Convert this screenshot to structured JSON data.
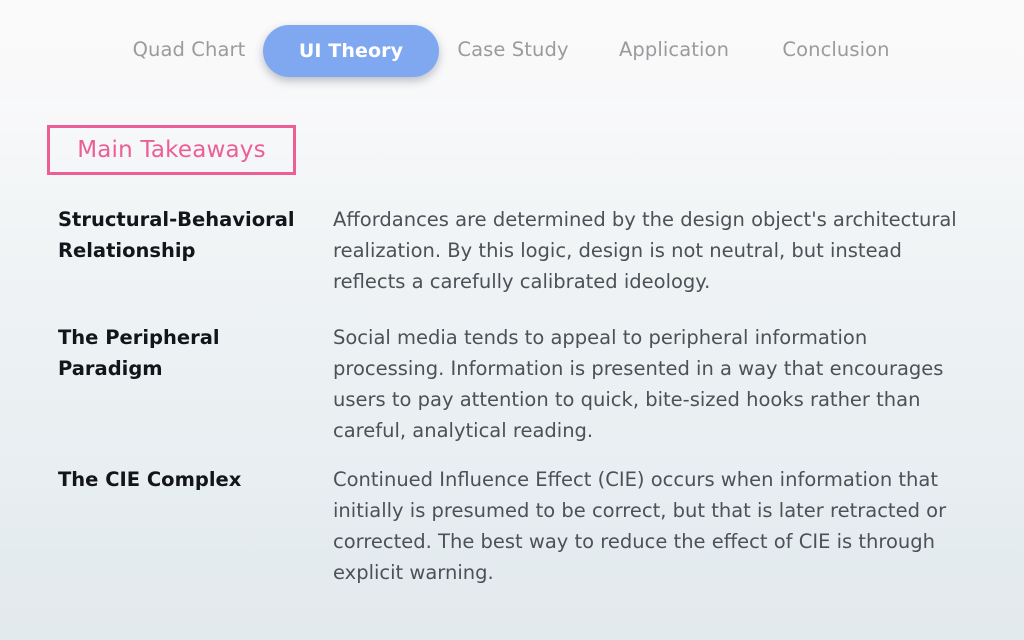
{
  "nav": {
    "tabs": [
      {
        "label": "Quad Chart",
        "active": false
      },
      {
        "label": "UI Theory",
        "active": true
      },
      {
        "label": "Case Study",
        "active": false
      },
      {
        "label": "Application",
        "active": false
      },
      {
        "label": "Conclusion",
        "active": false
      }
    ],
    "active_color": "#7fa8f0",
    "inactive_color": "#9b9b9f"
  },
  "section": {
    "title": "Main Takeaways",
    "title_color": "#ec5f95",
    "border_color": "#ec5f95"
  },
  "takeaways": [
    {
      "heading": "Structural-Behavioral Relationship",
      "body": "Affordances are determined by the design object's architectural realization. By this logic, design is not neutral, but instead reflects a carefully calibrated ideology."
    },
    {
      "heading": "The Peripheral Paradigm",
      "body": "Social media tends to appeal to peripheral information processing. Information is presented in a way that encourages users to pay attention to quick, bite-sized hooks rather than careful, analytical reading."
    },
    {
      "heading": "The CIE Complex",
      "body": "Continued Influence Effect (CIE) occurs when information that initially is presumed to be correct, but that is later retracted or corrected. The best way to reduce the effect of CIE is through explicit warning."
    }
  ],
  "theme": {
    "background_top": "#fafafa",
    "background_bottom": "#e3eaee",
    "heading_text_color": "#12161a",
    "body_text_color": "#4c5157"
  }
}
